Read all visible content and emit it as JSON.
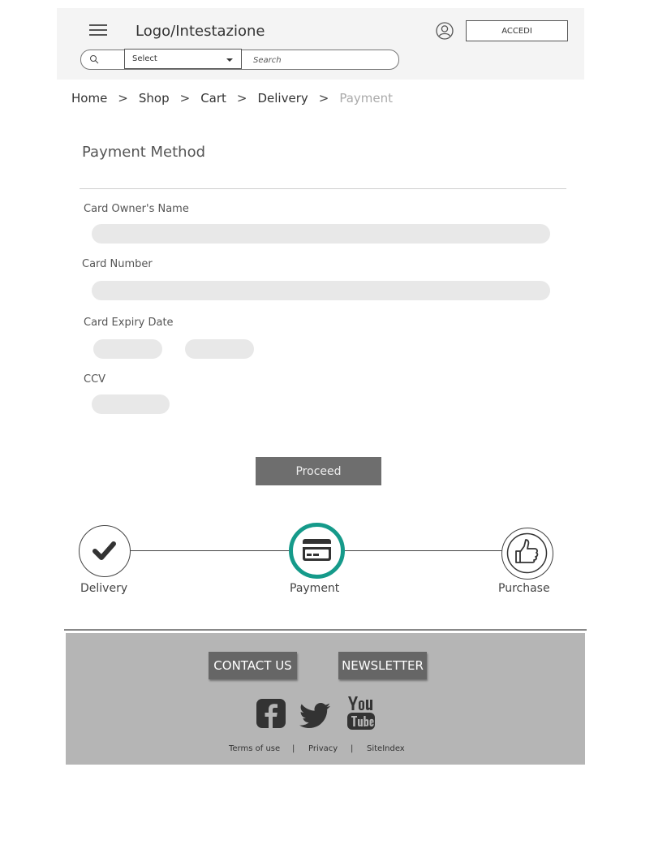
{
  "header": {
    "logo_text": "Logo/Intestazione",
    "login_button": "ACCEDI",
    "select_label": "Select",
    "search_placeholder": "Search"
  },
  "breadcrumb": {
    "items": [
      "Home",
      "Shop",
      "Cart",
      "Delivery"
    ],
    "current": "Payment",
    "separator": ">"
  },
  "form": {
    "title": "Payment Method",
    "owner_label": "Card Owner's Name",
    "number_label": "Card Number",
    "expiry_label": "Card Expiry Date",
    "ccv_label": "CCV",
    "proceed_label": "Proceed"
  },
  "steps": [
    {
      "label": "Delivery",
      "icon": "checkmark-icon",
      "state": "done"
    },
    {
      "label": "Payment",
      "icon": "credit-card-icon",
      "state": "active"
    },
    {
      "label": "Purchase",
      "icon": "thumbs-up-icon",
      "state": "pending"
    }
  ],
  "footer": {
    "contact_label": "CONTACT US",
    "newsletter_label": "NEWSLETTER",
    "links": [
      "Terms of use",
      "Privacy",
      "SiteIndex"
    ],
    "link_separator": "|",
    "social": [
      "facebook-icon",
      "twitter-icon",
      "youtube-icon"
    ]
  },
  "colors": {
    "active_step": "#159a8a",
    "header_bg": "#f4f4f4",
    "footer_bg": "#b5b5b5",
    "button_bg": "#6e6e6e"
  }
}
